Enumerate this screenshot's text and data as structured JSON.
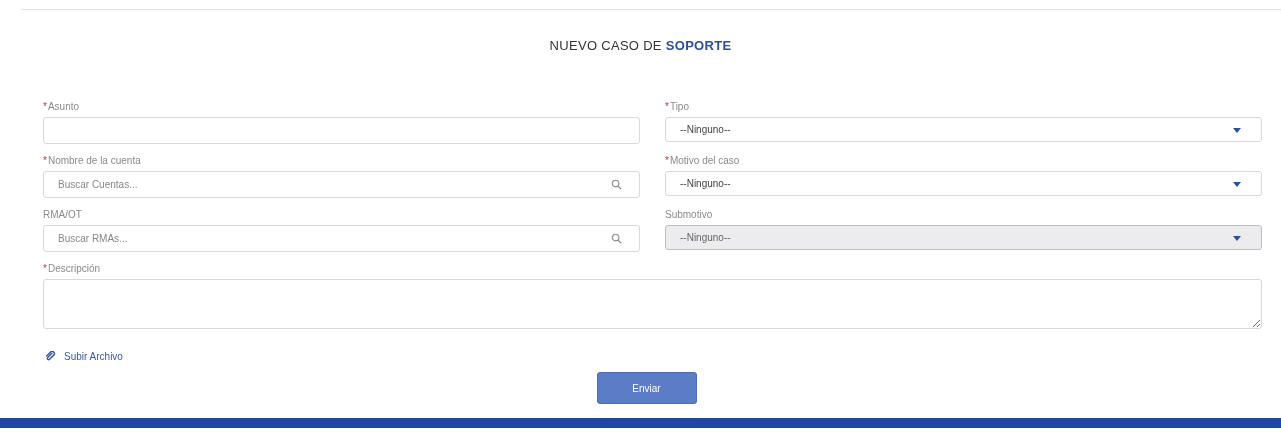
{
  "title": "NUEVO CASO DE **SOPORTE**",
  "fields": [
    {
      "kind": "text",
      "label": "Asunto",
      "marker": "*"
    },
    {
      "kind": "select",
      "label": "Tipo",
      "marker": "*",
      "value": "--Ninguno--",
      "disabled": false
    },
    {
      "kind": "lookup",
      "label": "Nombre de la cuenta",
      "marker": "*",
      "placeholder": "Buscar Cuentas..."
    },
    {
      "kind": "select",
      "label": "Motivo del caso",
      "marker": "*",
      "value": "--Ninguno--",
      "disabled": false
    },
    {
      "kind": "lookup",
      "label": "RMA/OT",
      "placeholder": "Buscar RMAs..."
    },
    {
      "kind": "select",
      "label": "Submotivo",
      "value": "--Ninguno--",
      "disabled": true
    }
  ],
  "description": {
    "label": "Descripción",
    "marker": "*"
  },
  "upload_link": "Subir Archivo",
  "submit_button": "Enviar"
}
